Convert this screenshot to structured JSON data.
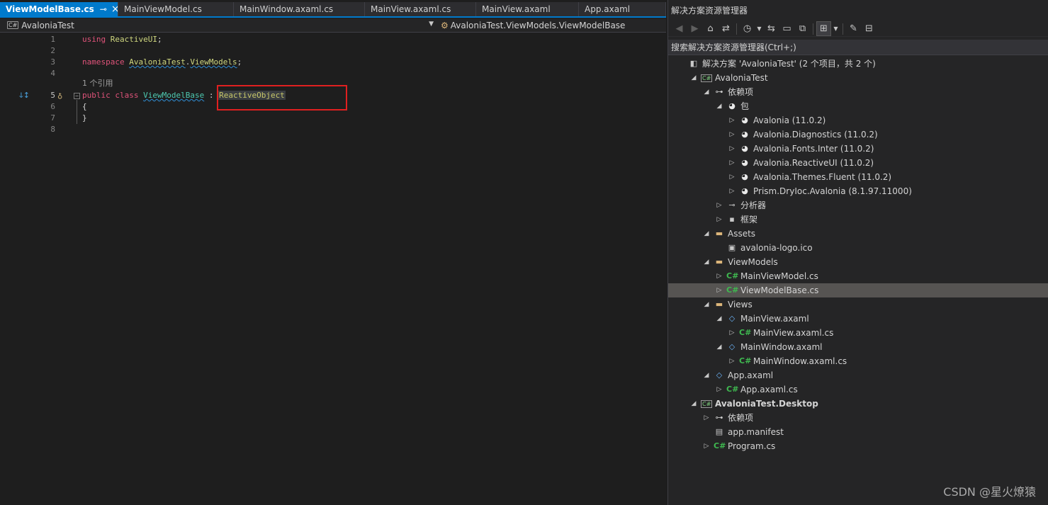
{
  "tabs": [
    {
      "label": "ViewModelBase.cs",
      "active": true
    },
    {
      "label": "MainViewModel.cs"
    },
    {
      "label": "MainWindow.axaml.cs"
    },
    {
      "label": "MainView.axaml.cs"
    },
    {
      "label": "MainView.axaml"
    },
    {
      "label": "App.axaml"
    }
  ],
  "tab_pin": "⊸",
  "tab_close": "×",
  "nav": {
    "project": "AvaloniaTest",
    "member": "AvaloniaTest.ViewModels.ViewModelBase",
    "project_badge": "C#"
  },
  "code": {
    "line_numbers": [
      "1",
      "2",
      "3",
      "4",
      "5",
      "6",
      "7",
      "8"
    ],
    "using_kw": "using",
    "using_ns": "ReactiveUI",
    "semicolon": ";",
    "namespace_kw": "namespace",
    "ns_part1": "AvaloniaTest",
    "dot": ".",
    "ns_part2": "ViewModels",
    "ref_count": "1 个引用",
    "public_kw": "public",
    "class_kw": "class",
    "class_name": "ViewModelBase",
    "colon": ":",
    "base_class": "ReactiveObject",
    "open_brace": "{",
    "close_brace": "}"
  },
  "explorer": {
    "title": "解决方案资源管理器",
    "search_placeholder": "搜索解决方案资源管理器(Ctrl+;)",
    "tree": [
      {
        "label": "解决方案 'AvaloniaTest' (2 个项目，共 2 个)",
        "icon": "solution-icon",
        "depth": 0,
        "arrow": ""
      },
      {
        "label": "AvaloniaTest",
        "icon": "csharp-project-icon",
        "depth": 1,
        "arrow": "expanded"
      },
      {
        "label": "依赖项",
        "icon": "dependencies-icon",
        "depth": 2,
        "arrow": "expanded"
      },
      {
        "label": "包",
        "icon": "package-icon",
        "depth": 3,
        "arrow": "expanded"
      },
      {
        "label": "Avalonia (11.0.2)",
        "icon": "package-icon",
        "depth": 4,
        "arrow": "collapsed"
      },
      {
        "label": "Avalonia.Diagnostics (11.0.2)",
        "icon": "package-icon",
        "depth": 4,
        "arrow": "collapsed"
      },
      {
        "label": "Avalonia.Fonts.Inter (11.0.2)",
        "icon": "package-icon",
        "depth": 4,
        "arrow": "collapsed"
      },
      {
        "label": "Avalonia.ReactiveUI (11.0.2)",
        "icon": "package-icon",
        "depth": 4,
        "arrow": "collapsed"
      },
      {
        "label": "Avalonia.Themes.Fluent (11.0.2)",
        "icon": "package-icon",
        "depth": 4,
        "arrow": "collapsed"
      },
      {
        "label": "Prism.DryIoc.Avalonia (8.1.97.11000)",
        "icon": "package-icon",
        "depth": 4,
        "arrow": "collapsed"
      },
      {
        "label": "分析器",
        "icon": "analyzer-icon",
        "depth": 3,
        "arrow": "collapsed"
      },
      {
        "label": "框架",
        "icon": "framework-icon",
        "depth": 3,
        "arrow": "collapsed"
      },
      {
        "label": "Assets",
        "icon": "folder-icon",
        "depth": 2,
        "arrow": "expanded"
      },
      {
        "label": "avalonia-logo.ico",
        "icon": "ico-file-icon",
        "depth": 3,
        "arrow": ""
      },
      {
        "label": "ViewModels",
        "icon": "folder-icon",
        "depth": 2,
        "arrow": "expanded"
      },
      {
        "label": "MainViewModel.cs",
        "icon": "csharp-file-icon",
        "depth": 3,
        "arrow": "collapsed"
      },
      {
        "label": "ViewModelBase.cs",
        "icon": "csharp-file-icon",
        "depth": 3,
        "arrow": "collapsed",
        "selected": true
      },
      {
        "label": "Views",
        "icon": "folder-icon",
        "depth": 2,
        "arrow": "expanded"
      },
      {
        "label": "MainView.axaml",
        "icon": "xaml-file-icon",
        "depth": 3,
        "arrow": "expanded"
      },
      {
        "label": "MainView.axaml.cs",
        "icon": "csharp-file-icon",
        "depth": 4,
        "arrow": "collapsed"
      },
      {
        "label": "MainWindow.axaml",
        "icon": "xaml-file-icon",
        "depth": 3,
        "arrow": "expanded"
      },
      {
        "label": "MainWindow.axaml.cs",
        "icon": "csharp-file-icon",
        "depth": 4,
        "arrow": "collapsed"
      },
      {
        "label": "App.axaml",
        "icon": "xaml-file-icon",
        "depth": 2,
        "arrow": "expanded"
      },
      {
        "label": "App.axaml.cs",
        "icon": "csharp-file-icon",
        "depth": 3,
        "arrow": "collapsed"
      },
      {
        "label": "AvaloniaTest.Desktop",
        "icon": "csharp-project-icon",
        "depth": 1,
        "arrow": "expanded",
        "bold": true
      },
      {
        "label": "依赖项",
        "icon": "dependencies-icon",
        "depth": 2,
        "arrow": "collapsed"
      },
      {
        "label": "app.manifest",
        "icon": "manifest-file-icon",
        "depth": 2,
        "arrow": ""
      },
      {
        "label": "Program.cs",
        "icon": "csharp-file-icon",
        "depth": 2,
        "arrow": "collapsed"
      }
    ]
  },
  "watermark": "CSDN @星火燎猿",
  "colors": {
    "accent": "#007acc",
    "highlight_box": "#e02020",
    "selection": "#565452",
    "keyword": "#e0537a",
    "type": "#4ec9b0"
  }
}
